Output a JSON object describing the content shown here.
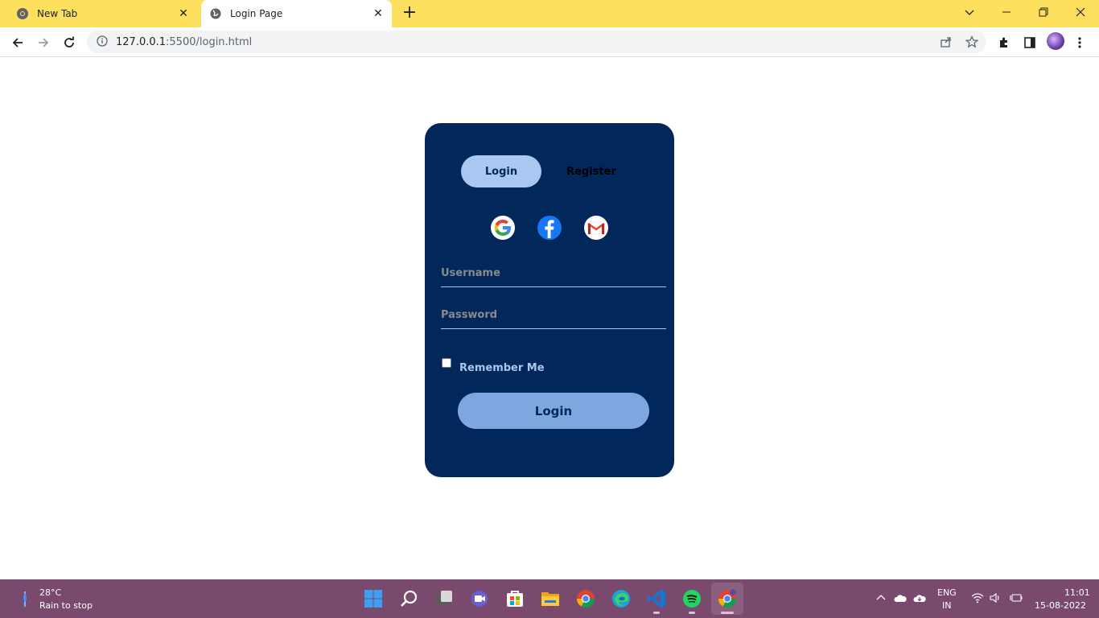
{
  "browser": {
    "tabs": [
      {
        "title": "New Tab",
        "active": false
      },
      {
        "title": "Login Page",
        "active": true
      }
    ],
    "new_tab_label": "+",
    "url_host": "127.0.0.1",
    "url_path": ":5500/login.html",
    "tab_strip_color": "#fde05e"
  },
  "card": {
    "toggle_login": "Login",
    "toggle_register": "Register",
    "social_icons": [
      "google-icon",
      "facebook-icon",
      "gmail-icon"
    ],
    "username_placeholder": "Username",
    "password_placeholder": "Password",
    "remember_label": "Remember Me",
    "remember_checked": false,
    "login_button": "Login",
    "colors": {
      "card_bg": "#02275a",
      "accent_light": "#a9c7f1",
      "button_bg": "#7fa7df"
    }
  },
  "taskbar": {
    "weather_temp": "28°C",
    "weather_desc": "Rain to stop",
    "apps": [
      "windows-start-icon",
      "search-icon",
      "task-view-icon",
      "chat-icon",
      "store-icon",
      "file-explorer-icon",
      "chrome-canary-icon",
      "edge-icon",
      "vscode-icon",
      "spotify-icon",
      "chrome-icon"
    ],
    "lang_line1": "ENG",
    "lang_line2": "IN",
    "time": "11:01",
    "date": "15-08-2022",
    "bg_color": "#7a4a6e"
  }
}
